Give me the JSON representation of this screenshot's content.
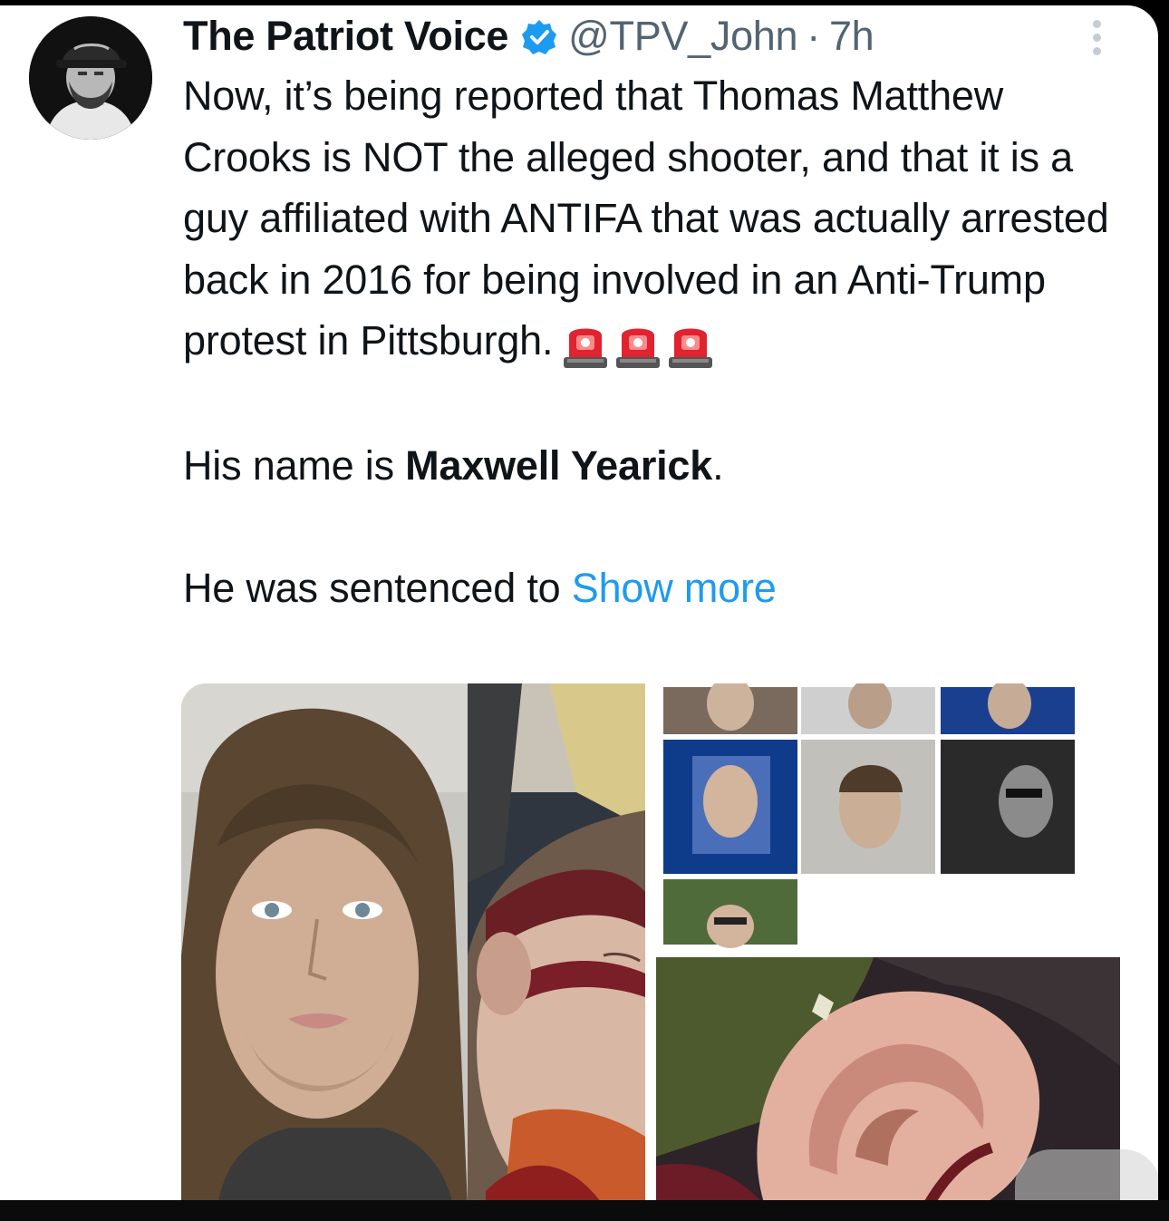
{
  "tweet": {
    "author": {
      "display_name": "The Patriot Voice",
      "verified": true,
      "handle": "@TPV_John",
      "separator": "·",
      "time": "7h",
      "avatar": "man-in-cap-avatar"
    },
    "text": {
      "paragraph1": "Now, it’s being reported that Thomas Matthew Crooks is NOT the alleged shooter, and that it is a guy affiliated with ANTIFA that was actually arrested back in 2016 for being involved in an Anti-Trump protest in Pittsburgh.",
      "paragraph1_emoji": [
        "police-light-icon",
        "police-light-icon",
        "police-light-icon"
      ],
      "paragraph2_prefix": "His name is ",
      "paragraph2_name": "Maxwell Yearick",
      "paragraph2_suffix": ".",
      "paragraph3": "He was sentenced to",
      "show_more": "Show more"
    },
    "media": {
      "count": 4,
      "items": [
        "mugshot-photo",
        "injured-man-photo",
        "search-results-collage",
        "ear-closeup-photo"
      ]
    },
    "icons": {
      "verified": "verified-badge-icon",
      "more": "more-options-icon"
    },
    "colors": {
      "accent": "#1d9bf0",
      "text": "#0f1419",
      "secondary": "#536471",
      "background": "#ffffff"
    }
  }
}
